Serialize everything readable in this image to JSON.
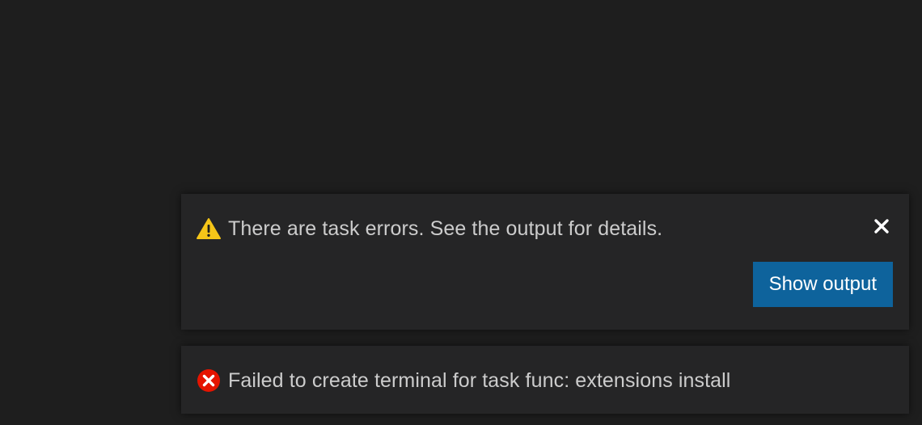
{
  "notifications": [
    {
      "severity": "warning",
      "icon": "warning-icon",
      "message": "There are task errors. See the output for details.",
      "close_icon": "close-icon",
      "action_label": "Show output"
    },
    {
      "severity": "error",
      "icon": "error-icon",
      "message": "Failed to create terminal for task func: extensions install"
    }
  ],
  "colors": {
    "background": "#1e1e1e",
    "toast_background": "#252526",
    "text": "#cccccc",
    "button": "#0e639c",
    "warning": "#f5c518",
    "error": "#e51400"
  }
}
